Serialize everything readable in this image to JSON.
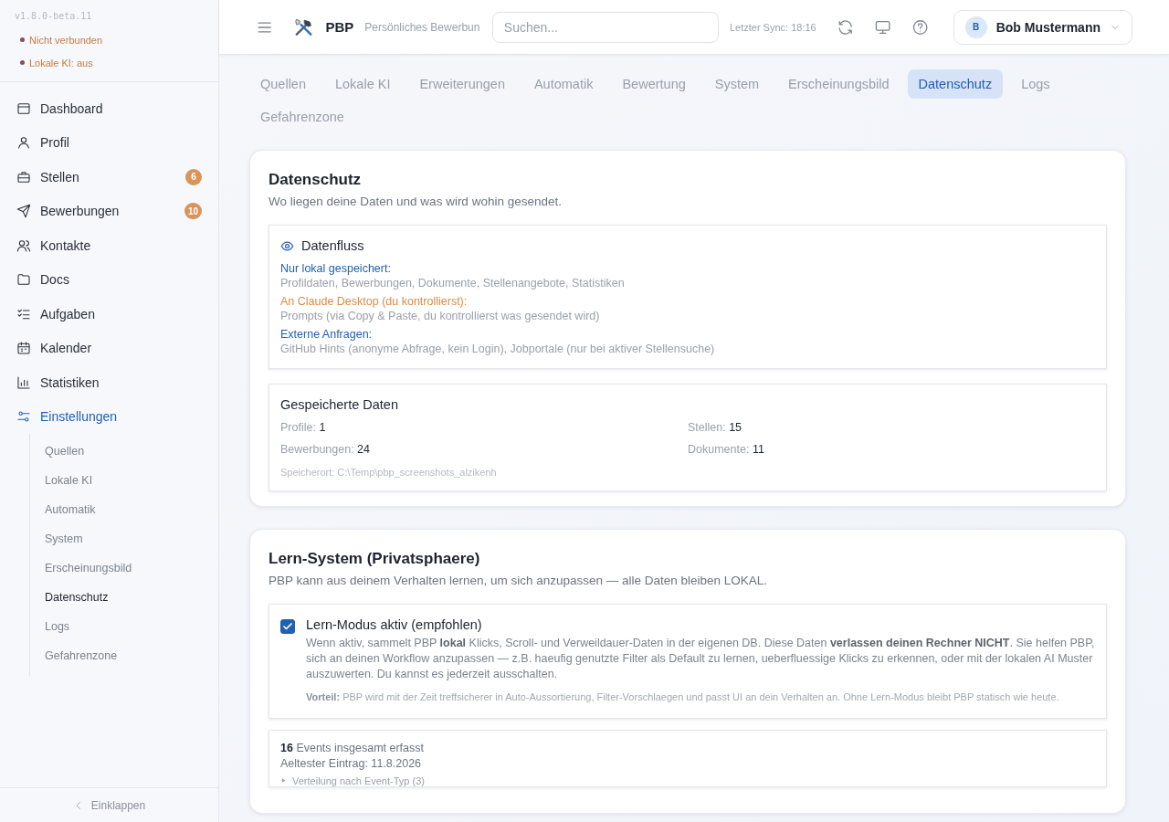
{
  "sidebar": {
    "version": "v1.8.0-beta.11",
    "status": [
      {
        "text": "Nicht verbunden",
        "color": "#8b4a5c"
      },
      {
        "text": "Lokale KI: aus",
        "color": "#8b4a5c"
      }
    ],
    "nav": [
      {
        "label": "Dashboard",
        "selected": false
      },
      {
        "label": "Profil",
        "selected": false
      },
      {
        "label": "Stellen",
        "badge": "6",
        "selected": false
      },
      {
        "label": "Bewerbungen",
        "badge": "10",
        "selected": false
      },
      {
        "label": "Kontakte",
        "selected": false
      },
      {
        "label": "Docs",
        "selected": false
      },
      {
        "label": "Aufgaben",
        "selected": false
      },
      {
        "label": "Kalender",
        "selected": false
      },
      {
        "label": "Statistiken",
        "selected": false
      },
      {
        "label": "Einstellungen",
        "selected": true,
        "children": [
          {
            "label": "Quellen",
            "selected": false
          },
          {
            "label": "Lokale KI",
            "selected": false
          },
          {
            "label": "Automatik",
            "selected": false
          },
          {
            "label": "System",
            "selected": false
          },
          {
            "label": "Erscheinungsbild",
            "selected": false
          },
          {
            "label": "Datenschutz",
            "selected": true
          },
          {
            "label": "Logs",
            "selected": false
          },
          {
            "label": "Gefahrenzone",
            "selected": false
          }
        ]
      }
    ],
    "collapse": "Einklappen"
  },
  "header": {
    "title": "PBP",
    "subtitle": "Persönliches Bewerbun",
    "search": {
      "placeholder": "Suchen..."
    },
    "sync": "Letzter Sync: 18:16",
    "user": {
      "initial": "B",
      "name": "Bob Mustermann"
    }
  },
  "tabs": [
    {
      "label": "Quellen",
      "selected": false
    },
    {
      "label": "Lokale KI",
      "selected": false
    },
    {
      "label": "Erweiterungen",
      "selected": false
    },
    {
      "label": "Automatik",
      "selected": false
    },
    {
      "label": "Bewertung",
      "selected": false
    },
    {
      "label": "System",
      "selected": false
    },
    {
      "label": "Erscheinungsbild",
      "selected": false
    },
    {
      "label": "Datenschutz",
      "selected": true
    },
    {
      "label": "Logs",
      "selected": false
    },
    {
      "label": "Gefahrenzone",
      "selected": false
    }
  ],
  "privacy": {
    "title": "Datenschutz",
    "subtitle": "Wo liegen deine Daten und was wird wohin gesendet.",
    "flow": {
      "title": "Datenfluss",
      "entries": [
        {
          "heading": "Nur lokal gespeichert:",
          "color": "#1f5fb8",
          "text": "Profildaten, Bewerbungen, Dokumente, Stellenangebote, Statistiken"
        },
        {
          "heading": "An Claude Desktop (du kontrollierst):",
          "color": "#d98b45",
          "text": "Prompts (via Copy & Paste, du kontrollierst was gesendet wird)"
        },
        {
          "heading": "Externe Anfragen:",
          "color": "#1f5fb8",
          "text": "GitHub Hints (anonyme Abfrage, kein Login), Jobportale (nur bei aktiver Stellensuche)"
        }
      ]
    },
    "stored": {
      "title": "Gespeicherte Daten",
      "stats": [
        {
          "label": "Profile:",
          "value": "1"
        },
        {
          "label": "Stellen:",
          "value": "15"
        },
        {
          "label": "Bewerbungen:",
          "value": "24"
        },
        {
          "label": "Dokumente:",
          "value": "11"
        }
      ],
      "location": "Speicherort: C:\\Temp\\pbp_screenshots_alzikenh"
    }
  },
  "learning": {
    "title": "Lern-System (Privatsphaere)",
    "subtitle": "PBP kann aus deinem Verhalten lernen, um sich anzupassen — alle Daten bleiben LOKAL.",
    "mode": {
      "label": "Lern-Modus aktiv (empfohlen)",
      "checked": true,
      "description": "Wenn aktiv, sammelt PBP **lokal** Klicks, Scroll- und Verweildauer-Daten in der eigenen DB. Diese Daten **verlassen deinen Rechner NICHT**. Sie helfen PBP, sich an deinen Workflow anzupassen — z.B. haeufig genutzte Filter als Default zu lernen, ueberfluessige Klicks zu erkennen, oder mit der lokalen AI Muster auszuwerten. Du kannst es jederzeit ausschalten.",
      "note": "**Vorteil:** PBP wird mit der Zeit treffsicherer in Auto-Aussortierung, Filter-Vorschlaegen und passt UI an dein Verhalten an. Ohne Lern-Modus bleibt PBP statisch wie heute."
    },
    "events": {
      "count": "**16** Events insgesamt erfasst",
      "oldest": "Aeltester Eintrag: 11.8.2026",
      "distribution": "Verteilung nach Event-Typ (3)",
      "expanded": false
    }
  }
}
